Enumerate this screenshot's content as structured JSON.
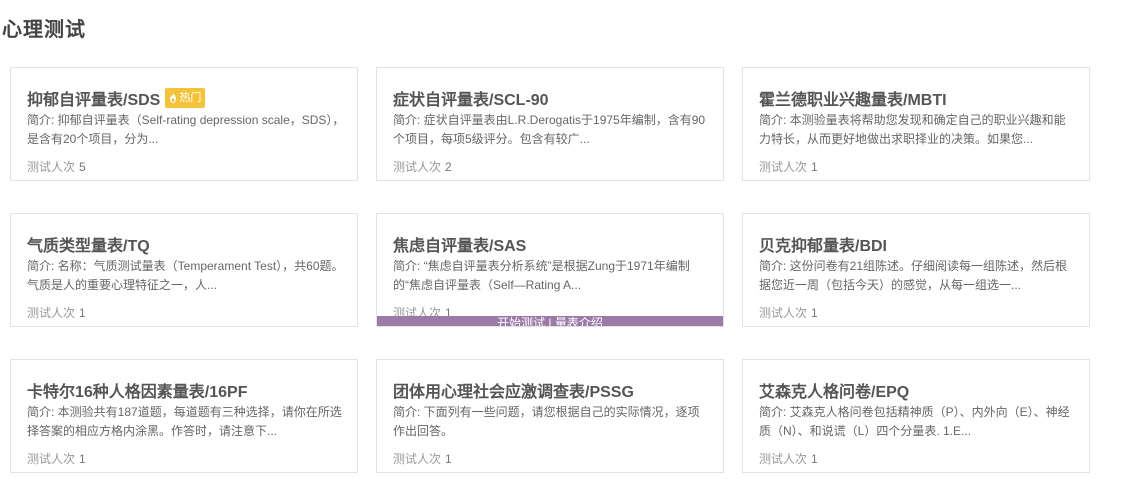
{
  "page": {
    "title": "心理测试"
  },
  "labels": {
    "desc_prefix": "简介: ",
    "count_label": "测试人次",
    "hot": "热门",
    "hover_action": "开始测试 | 量表介绍"
  },
  "colors": {
    "hot_badge": "#f5c33b",
    "hover_bar": "#9b7aa8"
  },
  "cards": [
    {
      "title": "抑郁自评量表/SDS",
      "hot": true,
      "desc": "简介: 抑郁自评量表（Self-rating depression scale，SDS），是含有20个项目，分为...",
      "count": "5"
    },
    {
      "title": "症状自评量表/SCL-90",
      "hot": false,
      "desc": "简介: 症状自评量表由L.R.Derogatis于1975年编制，含有90个项目，每项5级评分。包含有较广...",
      "count": "2"
    },
    {
      "title": "霍兰德职业兴趣量表/MBTI",
      "hot": false,
      "desc": "简介: 本测验量表将帮助您发现和确定自己的职业兴趣和能力特长，从而更好地做出求职择业的决策。如果您...",
      "count": "1"
    },
    {
      "title": "气质类型量表/TQ",
      "hot": false,
      "desc": "简介: 名称：气质测试量表（Temperament Test），共60题。 气质是人的重要心理特征之一，人...",
      "count": "1"
    },
    {
      "title": "焦虑自评量表/SAS",
      "hot": false,
      "desc": "简介: “焦虑自评量表分析系统”是根据Zung于1971年编制的“焦虑自评量表（Self—Rating A...",
      "count": "1",
      "hovered": true
    },
    {
      "title": "贝克抑郁量表/BDI",
      "hot": false,
      "desc": "简介: 这份问卷有21组陈述。仔细阅读每一组陈述，然后根据您近一周（包括今天）的感觉，从每一组选一...",
      "count": "1"
    },
    {
      "title": "卡特尔16种人格因素量表/16PF",
      "hot": false,
      "desc": "简介: 本测验共有187道题，每道题有三种选择，请你在所选择答案的相应方格内涂黑。作答时，请注意下...",
      "count": "1"
    },
    {
      "title": "团体用心理社会应激调查表/PSSG",
      "hot": false,
      "desc": "简介: 下面列有一些问题，请您根据自己的实际情况，逐项作出回答。",
      "count": "1"
    },
    {
      "title": "艾森克人格问卷/EPQ",
      "hot": false,
      "desc": "简介: 艾森克人格问卷包括精神质（P）、内外向（E）、神经质（N）、和说谎（L）四个分量表. 1.E...",
      "count": "1"
    }
  ]
}
